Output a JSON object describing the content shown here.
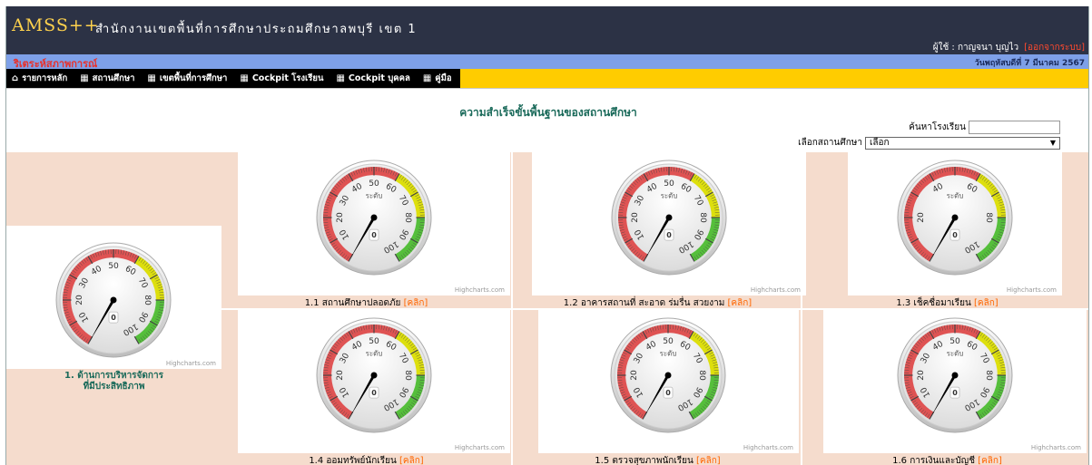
{
  "header": {
    "app_name": "AMSS++",
    "org_name": "สำนักงานเขตพื้นที่การศึกษาประถมศึกษาลพบุรี เขต 1",
    "user_label": "ผู้ใช้ : กาญจนา บุญไว",
    "logout_label": "[ออกจากระบบ]"
  },
  "subbar": {
    "title": "ริเตระห์สภาพการณ์",
    "date": "วันพฤหัสบดีที่ 7 มีนาคม 2567"
  },
  "nav": [
    {
      "icon": "home-icon",
      "label": "รายการหลัก"
    },
    {
      "icon": "grid-icon",
      "label": "สถานศึกษา"
    },
    {
      "icon": "grid-icon",
      "label": "เขตพื้นที่การศึกษา"
    },
    {
      "icon": "grid-icon",
      "label": "Cockpit โรงเรียน"
    },
    {
      "icon": "grid-icon",
      "label": "Cockpit บุคคล"
    },
    {
      "icon": "grid-icon",
      "label": "คู่มือ"
    }
  ],
  "page": {
    "title": "ความสำเร็จขั้นพื้นฐานของสถานศึกษา",
    "search_label": "ค้นหาโรงเรียน",
    "search_value": "",
    "select_label": "เลือกสถานศึกษา",
    "select_value": "เลือก"
  },
  "gauge_common": {
    "unit_label": "ระดับ",
    "credit": "Highcharts.com",
    "click_label": "[คลิก]",
    "colors": {
      "red": "#df5353",
      "yellow": "#dddf0d",
      "green": "#55bf3b"
    }
  },
  "main_gauge": {
    "caption_line1": "1. ด้านการบริหารจัดการ",
    "caption_line2": "ที่มีประสิทธิภาพ",
    "value": 0,
    "min": 0,
    "max": 100,
    "ticks": [
      10,
      20,
      30,
      40,
      50,
      60,
      70,
      80,
      90,
      100
    ],
    "show_unit": false
  },
  "gauges": [
    {
      "caption": "1.1 สถานศึกษาปลอดภัย",
      "value": 0,
      "min": 0,
      "max": 100,
      "ticks": [
        10,
        20,
        30,
        40,
        50,
        60,
        70,
        80,
        90,
        100
      ],
      "show_unit": true
    },
    {
      "caption": "1.2 อาคารสถานที่ สะอาด ร่มรื่น สวยงาม",
      "value": 0,
      "min": 0,
      "max": 100,
      "ticks": [
        10,
        20,
        30,
        40,
        50,
        60,
        70,
        80,
        90,
        100
      ],
      "show_unit": true
    },
    {
      "caption": "1.3 เช็คชื่อมาเรียน",
      "value": 0,
      "min": 0,
      "max": 100,
      "ticks": [
        20,
        40,
        60,
        80,
        100
      ],
      "show_unit": true
    },
    {
      "caption": "1.4 ออมทรัพย์นักเรียน",
      "value": 0,
      "min": 0,
      "max": 100,
      "ticks": [
        10,
        20,
        30,
        40,
        50,
        60,
        70,
        80,
        90,
        100
      ],
      "show_unit": true
    },
    {
      "caption": "1.5 ตรวจสุขภาพนักเรียน",
      "value": 0,
      "min": 0,
      "max": 100,
      "ticks": [
        10,
        20,
        30,
        40,
        50,
        60,
        70,
        80,
        90,
        100
      ],
      "show_unit": true
    },
    {
      "caption": "1.6 การเงินและบัญชี",
      "value": 0,
      "min": 0,
      "max": 100,
      "ticks": [
        10,
        20,
        30,
        40,
        50,
        60,
        70,
        80,
        90,
        100
      ],
      "show_unit": true
    }
  ]
}
